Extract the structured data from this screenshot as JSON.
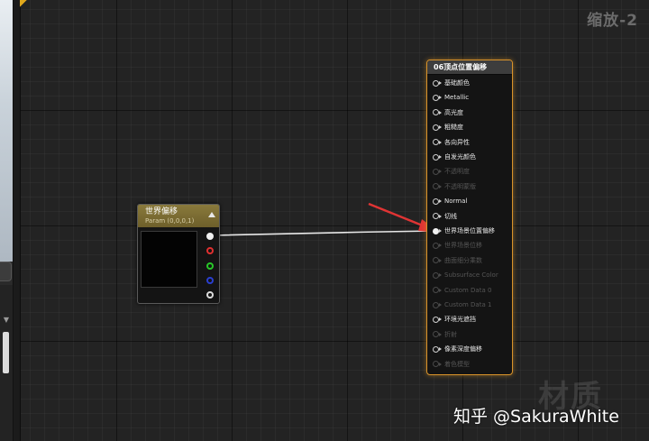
{
  "graph": {
    "zoom_label": "缩放-2"
  },
  "param_node": {
    "title": "世界偏移",
    "subtitle": "Param (0,0,0,1)",
    "outputs": [
      "rgba",
      "r",
      "g",
      "b",
      "a"
    ]
  },
  "material_node": {
    "title": "06顶点位置偏移",
    "inputs": [
      {
        "label": "基础颜色",
        "enabled": true,
        "connected": false
      },
      {
        "label": "Metallic",
        "enabled": true,
        "connected": false
      },
      {
        "label": "高光度",
        "enabled": true,
        "connected": false
      },
      {
        "label": "粗糙度",
        "enabled": true,
        "connected": false
      },
      {
        "label": "各向异性",
        "enabled": true,
        "connected": false
      },
      {
        "label": "自发光颜色",
        "enabled": true,
        "connected": false
      },
      {
        "label": "不透明度",
        "enabled": false,
        "connected": false
      },
      {
        "label": "不透明蒙版",
        "enabled": false,
        "connected": false
      },
      {
        "label": "Normal",
        "enabled": true,
        "connected": false
      },
      {
        "label": "切线",
        "enabled": true,
        "connected": false
      },
      {
        "label": "世界场景位置偏移",
        "enabled": true,
        "connected": true
      },
      {
        "label": "世界场景位移",
        "enabled": false,
        "connected": false
      },
      {
        "label": "曲面细分乘数",
        "enabled": false,
        "connected": false
      },
      {
        "label": "Subsurface Color",
        "enabled": false,
        "connected": false
      },
      {
        "label": "Custom Data 0",
        "enabled": false,
        "connected": false
      },
      {
        "label": "Custom Data 1",
        "enabled": false,
        "connected": false
      },
      {
        "label": "环境光遮挡",
        "enabled": true,
        "connected": false
      },
      {
        "label": "折射",
        "enabled": false,
        "connected": false
      },
      {
        "label": "像素深度偏移",
        "enabled": true,
        "connected": false
      },
      {
        "label": "着色模型",
        "enabled": false,
        "connected": false
      }
    ]
  },
  "watermark": {
    "large_text": "材质",
    "credit": "知乎 @SakuraWhite"
  },
  "colors": {
    "accent_orange": "#d9932a",
    "wire": "#e8e8e8",
    "arrow": "#e03434",
    "param_header": "#7d6e34"
  },
  "icons": [
    "collapse-arrow-icon",
    "pin-icon",
    "annotation-arrow-icon"
  ]
}
